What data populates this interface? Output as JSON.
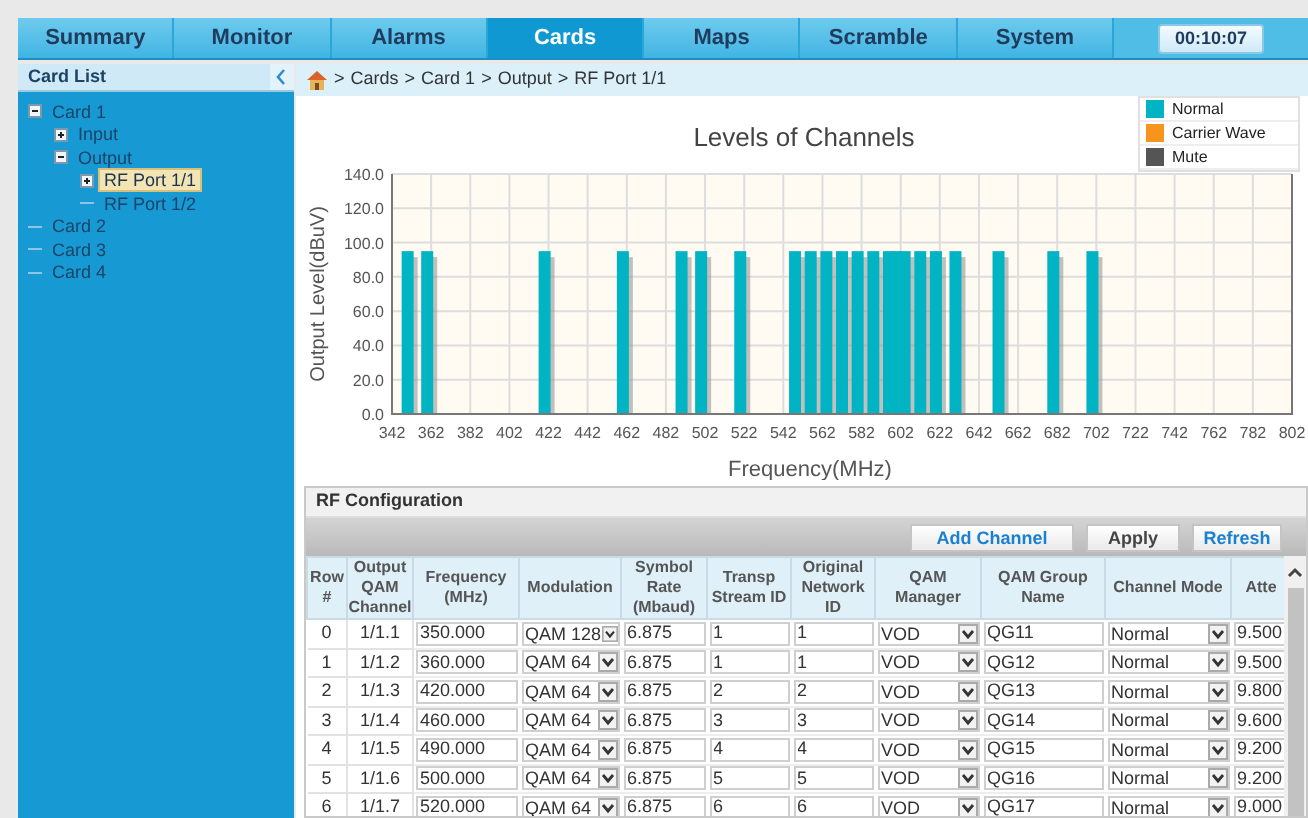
{
  "tabs": [
    {
      "label": "Summary",
      "selected": false
    },
    {
      "label": "Monitor",
      "selected": false
    },
    {
      "label": "Alarms",
      "selected": false
    },
    {
      "label": "Cards",
      "selected": true
    },
    {
      "label": "Maps",
      "selected": false
    },
    {
      "label": "Scramble",
      "selected": false
    },
    {
      "label": "System",
      "selected": false
    }
  ],
  "timer": "00:10:07",
  "sidebar": {
    "title": "Card List",
    "items": [
      {
        "label": "Card 1",
        "expanded": true,
        "selected": false,
        "children": [
          {
            "label": "Input",
            "expanded": false,
            "selected": false
          },
          {
            "label": "Output",
            "expanded": true,
            "selected": false,
            "children": [
              {
                "label": "RF Port 1/1",
                "expanded": false,
                "selected": true
              },
              {
                "label": "RF Port 1/2",
                "selected": false
              }
            ]
          }
        ]
      },
      {
        "label": "Card 2",
        "selected": false
      },
      {
        "label": "Card 3",
        "selected": false
      },
      {
        "label": "Card 4",
        "selected": false
      }
    ]
  },
  "breadcrumb": {
    "separator": ">",
    "items": [
      "Cards",
      "Card 1",
      "Output",
      "RF Port 1/1"
    ]
  },
  "chart_data": {
    "type": "bar",
    "title": "Levels of Channels",
    "xlabel": "Frequency(MHz)",
    "ylabel": "Output Level(dBuV)",
    "x": [
      350,
      360,
      420,
      460,
      490,
      500,
      520,
      548,
      556,
      564,
      572,
      580,
      588,
      596,
      600,
      604,
      612,
      620,
      630,
      652,
      680,
      700
    ],
    "series": [
      {
        "name": "Normal",
        "color": "#00b4c4",
        "values": [
          95,
          95,
          95,
          95,
          95,
          95,
          95,
          95,
          95,
          95,
          95,
          95,
          95,
          95,
          95,
          95,
          95,
          95,
          95,
          95,
          95,
          95
        ]
      },
      {
        "name": "Carrier Wave",
        "color": "#f7941d",
        "values": [
          null,
          null,
          null,
          null,
          null,
          null,
          null,
          null,
          null,
          null,
          null,
          null,
          null,
          null,
          null,
          null,
          null,
          null,
          null,
          null,
          null,
          null
        ]
      },
      {
        "name": "Mute",
        "color": "#555555",
        "values": [
          null,
          null,
          null,
          null,
          null,
          null,
          null,
          null,
          null,
          null,
          null,
          null,
          null,
          null,
          null,
          null,
          null,
          null,
          null,
          null,
          null,
          null
        ]
      }
    ],
    "grid": true,
    "xlim": [
      342,
      802
    ],
    "ylim": [
      0,
      140
    ],
    "xticks": [
      342,
      362,
      382,
      402,
      422,
      442,
      462,
      482,
      502,
      522,
      542,
      562,
      582,
      602,
      622,
      642,
      662,
      682,
      702,
      722,
      742,
      762,
      782,
      802
    ],
    "yticks": [
      {
        "value": 0,
        "label": "0.0"
      },
      {
        "value": 20,
        "label": "20.0"
      },
      {
        "value": 40,
        "label": "40.0"
      },
      {
        "value": 60,
        "label": "60.0"
      },
      {
        "value": 80,
        "label": "80.0"
      },
      {
        "value": 100,
        "label": "100.0"
      },
      {
        "value": 120,
        "label": "120.0"
      },
      {
        "value": 140,
        "label": "140.0"
      }
    ]
  },
  "rf_config": {
    "title": "RF Configuration",
    "buttons": [
      "Add Channel",
      "Apply",
      "Refresh"
    ],
    "columns": [
      {
        "label": "Row #",
        "kind": "text"
      },
      {
        "label": "Output QAM Channel",
        "kind": "text"
      },
      {
        "label": "Frequency (MHz)",
        "kind": "input"
      },
      {
        "label": "Modulation",
        "kind": "select"
      },
      {
        "label": "Symbol Rate (Mbaud)",
        "kind": "input"
      },
      {
        "label": "Transp Stream ID",
        "kind": "input"
      },
      {
        "label": "Original Network ID",
        "kind": "input"
      },
      {
        "label": "QAM Manager",
        "kind": "select"
      },
      {
        "label": "QAM Group Name",
        "kind": "input"
      },
      {
        "label": "Channel Mode",
        "kind": "select"
      },
      {
        "label": "Atte",
        "kind": "input"
      }
    ],
    "rows": [
      [
        "0",
        "1/1.1",
        "350.000",
        "QAM 128",
        "6.875",
        "1",
        "1",
        "VOD",
        "QG11",
        "Normal",
        "9.500"
      ],
      [
        "1",
        "1/1.2",
        "360.000",
        "QAM 64",
        "6.875",
        "1",
        "1",
        "VOD",
        "QG12",
        "Normal",
        "9.500"
      ],
      [
        "2",
        "1/1.3",
        "420.000",
        "QAM 64",
        "6.875",
        "2",
        "2",
        "VOD",
        "QG13",
        "Normal",
        "9.800"
      ],
      [
        "3",
        "1/1.4",
        "460.000",
        "QAM 64",
        "6.875",
        "3",
        "3",
        "VOD",
        "QG14",
        "Normal",
        "9.600"
      ],
      [
        "4",
        "1/1.5",
        "490.000",
        "QAM 64",
        "6.875",
        "4",
        "4",
        "VOD",
        "QG15",
        "Normal",
        "9.200"
      ],
      [
        "5",
        "1/1.6",
        "500.000",
        "QAM 64",
        "6.875",
        "5",
        "5",
        "VOD",
        "QG16",
        "Normal",
        "9.200"
      ],
      [
        "6",
        "1/1.7",
        "520.000",
        "QAM 64",
        "6.875",
        "6",
        "6",
        "VOD",
        "QG17",
        "Normal",
        "9.000"
      ]
    ]
  }
}
